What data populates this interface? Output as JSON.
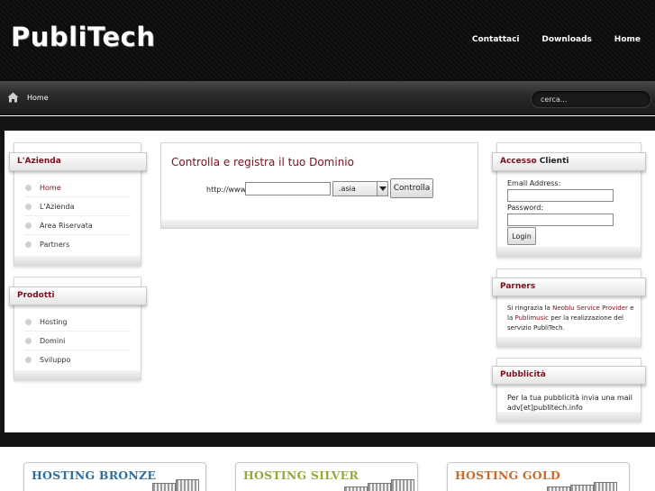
{
  "header": {
    "logo_text": "PubliTech",
    "nav": [
      "Contattaci",
      "Downloads",
      "Home"
    ]
  },
  "breadcrumb": {
    "home_label": "Home",
    "search_placeholder": "cerca..."
  },
  "sidebar_left": {
    "azienda": {
      "title": "L'Azienda",
      "items": [
        {
          "label": "Home",
          "active": true
        },
        {
          "label": "L'Azienda",
          "active": false
        },
        {
          "label": "Area Riservata",
          "active": false
        },
        {
          "label": "Partners",
          "active": false
        }
      ]
    },
    "prodotti": {
      "title": "Prodotti",
      "items": [
        {
          "label": "Hosting"
        },
        {
          "label": "Domini"
        },
        {
          "label": "Sviluppo"
        }
      ]
    }
  },
  "domain_check": {
    "title": "Controlla e registra il tuo Dominio",
    "prefix_label": "http://www.",
    "domain_value": "",
    "tld_selected": ".asia",
    "button_label": "Controlla"
  },
  "sidebar_right": {
    "accesso": {
      "title_part1": "Accesso",
      "title_part2": "Clienti",
      "email_label": "Email Address:",
      "password_label": "Password:",
      "login_label": "Login"
    },
    "parners": {
      "title": "Parners",
      "text_1": "Si ringrazia la",
      "link_1": "Neoblu Service Provider",
      "text_2": "e la",
      "link_2": "Publimusic",
      "text_3": "per la realizzazione del servizio PubliTech."
    },
    "pubblicita": {
      "title": "Pubblicità",
      "text_line1": "Per la tua pubblicità invia una mail",
      "text_line2": "adv[et]publitech.info"
    }
  },
  "hosting_cards": [
    {
      "title": "HOSTING BRONZE",
      "color": "#2f6f9f"
    },
    {
      "title": "HOSTING SILVER",
      "color": "#9aa83a"
    },
    {
      "title": "HOSTING GOLD",
      "color": "#cc6a2c"
    }
  ],
  "colors": {
    "accent": "#7a0f1d",
    "header_bg": "#0b0b0b"
  }
}
